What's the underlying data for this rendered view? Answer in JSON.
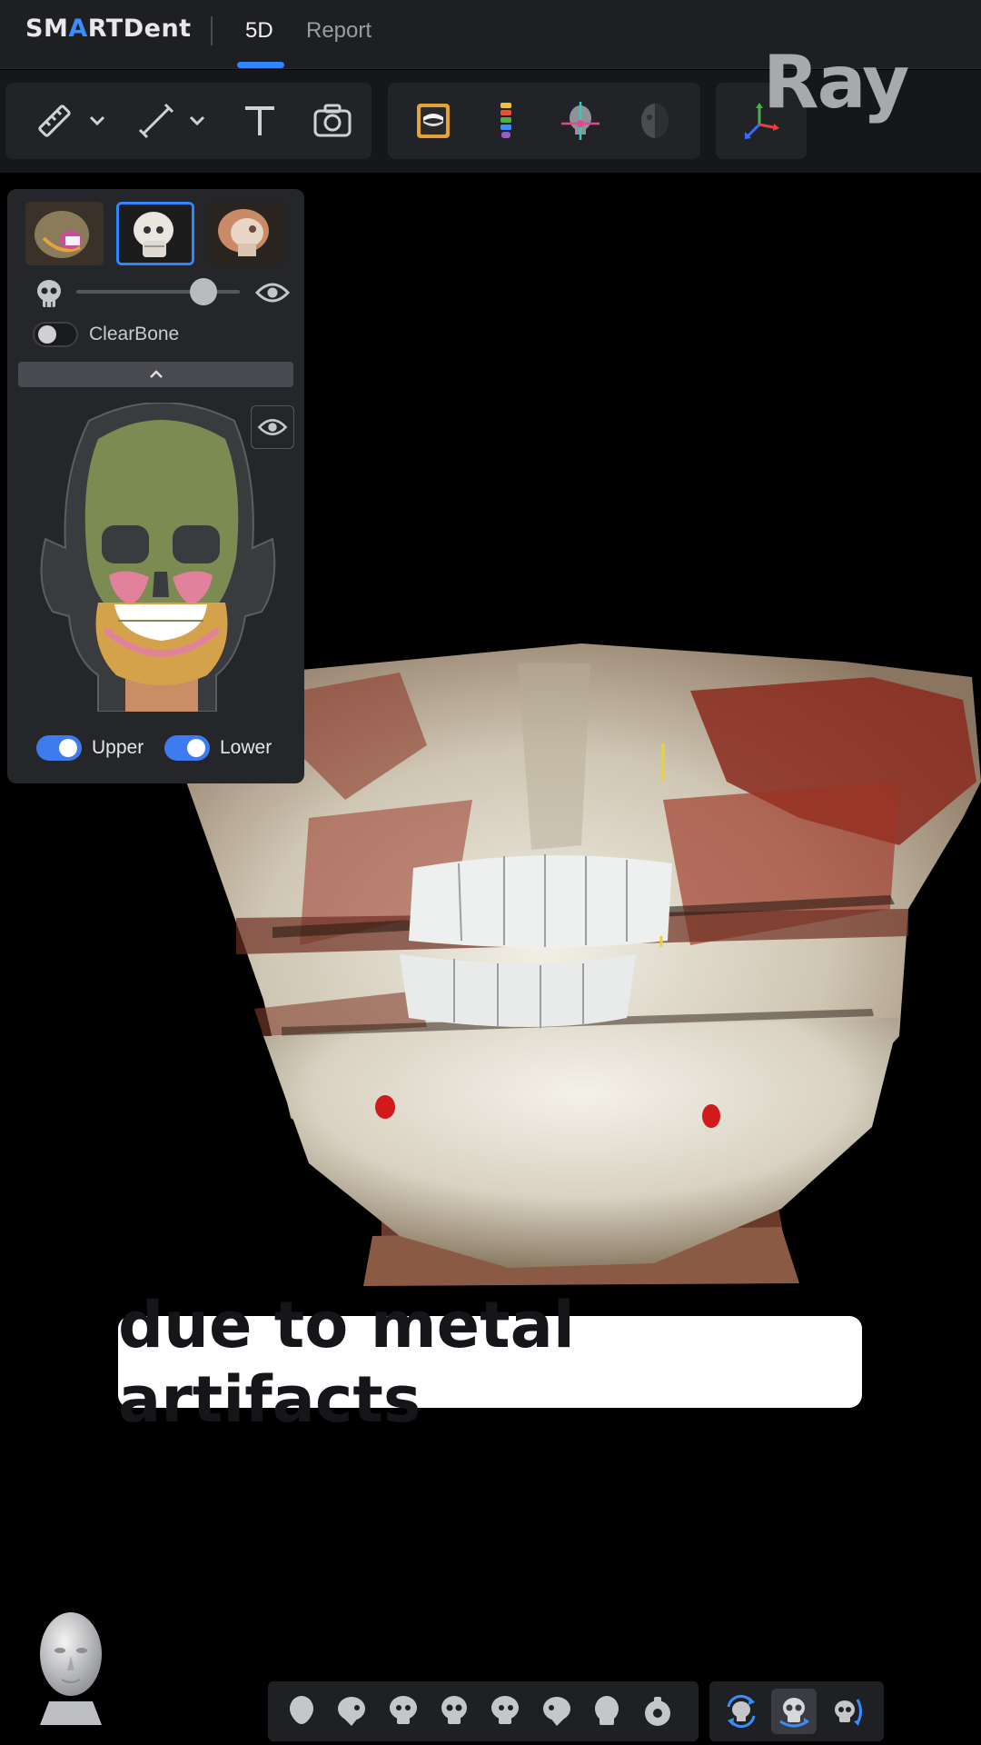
{
  "app": {
    "logo_text_pre": "SM",
    "logo_text_accent": "A",
    "logo_text_post": "RTDent",
    "brand_watermark": "Ray"
  },
  "tabs": [
    {
      "label": "5D",
      "active": true
    },
    {
      "label": "Report",
      "active": false
    }
  ],
  "toolbar": {
    "groups": [
      {
        "tools": [
          "ruler-icon",
          "chevron-down-icon",
          "line-measure-icon",
          "chevron-down-icon",
          "text-icon",
          "camera-icon"
        ]
      },
      {
        "tools": [
          "panoramic-icon",
          "implant-icon",
          "landmark-icon",
          "face-mask-icon"
        ]
      },
      {
        "tools": [
          "axis-icon"
        ]
      }
    ]
  },
  "panel": {
    "thumbnails": [
      "render-preset-1",
      "render-preset-2",
      "render-preset-3"
    ],
    "selected_thumbnail": 1,
    "opacity_level": 0.78,
    "clearbone_label": "ClearBone",
    "clearbone_on": false,
    "upper_label": "Upper",
    "upper_on": true,
    "lower_label": "Lower",
    "lower_on": true
  },
  "caption": {
    "text": "due to metal artifacts"
  },
  "view_presets": {
    "items": [
      "front-view",
      "right-lateral-view",
      "left-oblique-view",
      "front-skull-view",
      "right-oblique-view",
      "left-lateral-view",
      "posterior-view",
      "top-view"
    ],
    "modes": [
      "rotate-mode",
      "skull-mode",
      "reset-rotation-mode"
    ],
    "active_mode": 1
  },
  "colors": {
    "accent": "#2f86ff",
    "toggle_on": "#3e7bf0",
    "panel_bg": "#25262a",
    "topbar_bg": "#1e1f22",
    "skull_green": "#7b8b52",
    "sinus_pink": "#e2819c"
  }
}
